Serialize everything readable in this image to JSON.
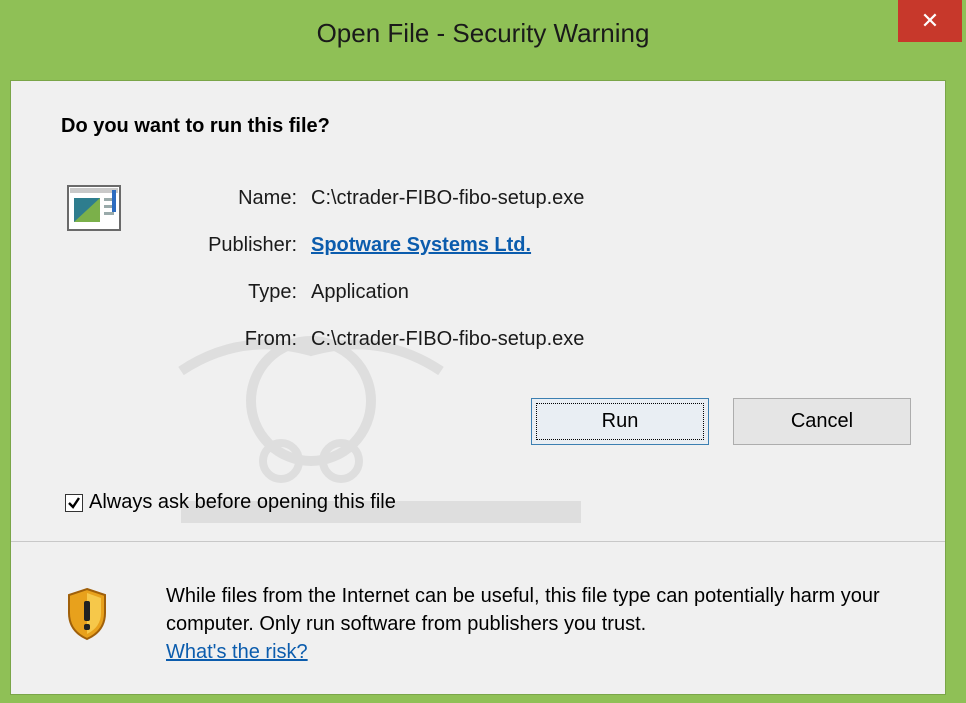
{
  "window": {
    "title": "Open File - Security Warning",
    "close_glyph": "✕"
  },
  "dialog": {
    "question": "Do you want to run this file?",
    "fields": [
      {
        "label": "Name:",
        "value": "C:\\ctrader-FIBO-fibo-setup.exe"
      },
      {
        "label": "Publisher:",
        "value": "Spotware Systems Ltd."
      },
      {
        "label": "Type:",
        "value": "Application"
      },
      {
        "label": "From:",
        "value": "C:\\ctrader-FIBO-fibo-setup.exe"
      }
    ],
    "run_label": "Run",
    "cancel_label": "Cancel",
    "always_ask_label": "Always ask before opening this file",
    "always_ask_checked": true
  },
  "warning": {
    "text": "While files from the Internet can be useful, this file type can potentially harm your computer. Only run software from publishers you trust.",
    "risk_link": "What's the risk?"
  },
  "colors": {
    "frame": "#8fc056",
    "close": "#c7382b",
    "link": "#0b5cad"
  },
  "icons": {
    "close": "close-icon",
    "file": "application-file-icon",
    "shield": "warning-shield-icon",
    "check": "checkmark-icon"
  }
}
